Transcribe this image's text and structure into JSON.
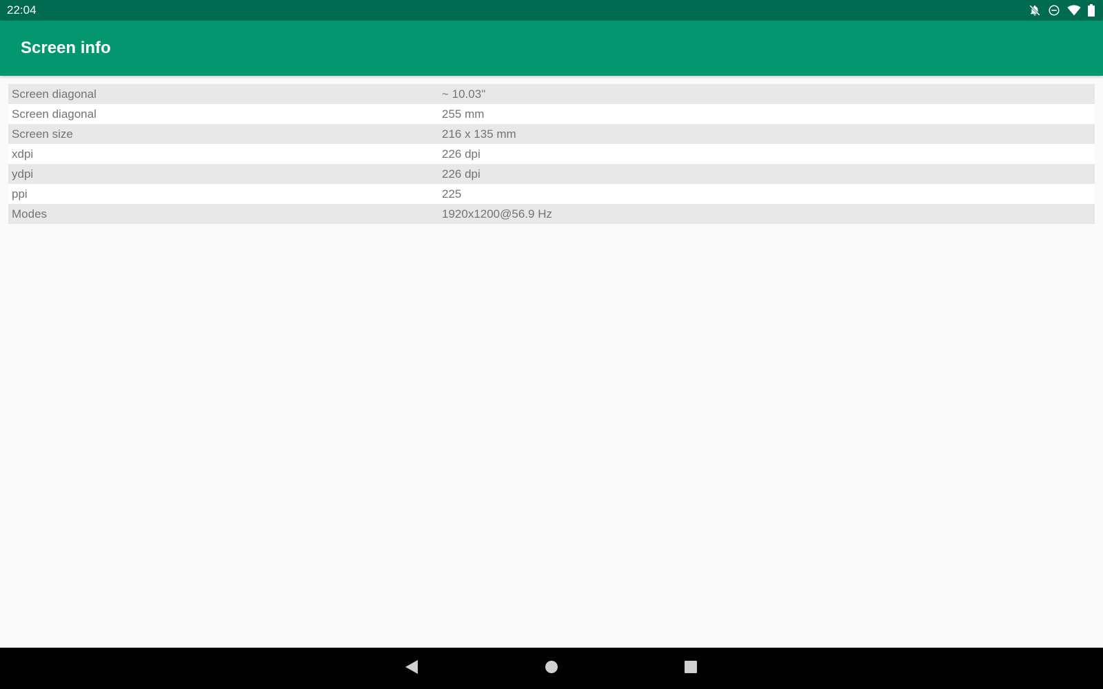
{
  "status_bar": {
    "time": "22:04",
    "icons": [
      "notifications-off-icon",
      "do-not-disturb-icon",
      "wifi-icon",
      "battery-icon"
    ]
  },
  "app_bar": {
    "title": "Screen info"
  },
  "info_rows": [
    {
      "label": "Screen diagonal",
      "value": "~ 10.03\""
    },
    {
      "label": "Screen diagonal",
      "value": "255 mm"
    },
    {
      "label": "Screen size",
      "value": "216 x 135 mm"
    },
    {
      "label": "xdpi",
      "value": "226 dpi"
    },
    {
      "label": "ydpi",
      "value": "226 dpi"
    },
    {
      "label": "ppi",
      "value": "225"
    },
    {
      "label": "Modes",
      "value": "1920x1200@56.9 Hz"
    }
  ],
  "nav_bar": {
    "buttons": [
      "back-icon",
      "home-icon",
      "recents-icon"
    ]
  },
  "colors": {
    "status_bar": "#006b50",
    "app_bar": "#04976f",
    "row_alt": "#e8e8e8",
    "text": "#737373"
  }
}
